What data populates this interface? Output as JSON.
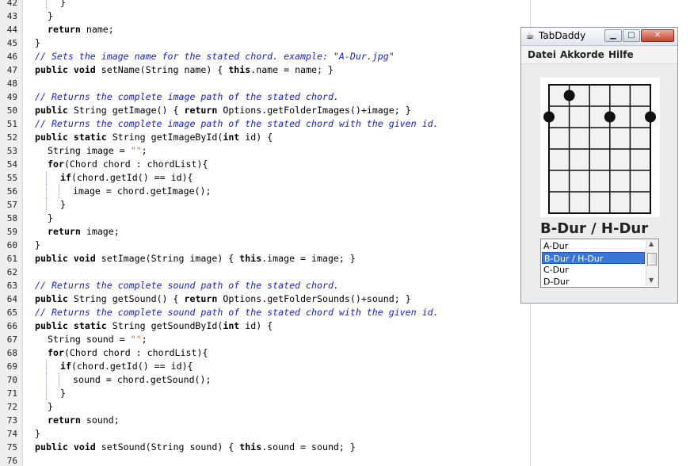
{
  "editor": {
    "lines": [
      {
        "n": "42",
        "indent": 3,
        "segs": [
          [
            "p",
            "}"
          ]
        ]
      },
      {
        "n": "43",
        "indent": 2,
        "segs": [
          [
            "p",
            "}"
          ]
        ]
      },
      {
        "n": "44",
        "indent": 2,
        "segs": [
          [
            "k",
            "return"
          ],
          [
            "p",
            " name;"
          ]
        ]
      },
      {
        "n": "45",
        "indent": 1,
        "segs": [
          [
            "p",
            "}"
          ]
        ]
      },
      {
        "n": "46",
        "indent": 1,
        "segs": [
          [
            "c",
            "// Sets the image name for the stated chord. example: \"A-Dur.jpg\""
          ]
        ]
      },
      {
        "n": "47",
        "indent": 1,
        "segs": [
          [
            "k",
            "public void"
          ],
          [
            "p",
            " setName(String name) { "
          ],
          [
            "k",
            "this"
          ],
          [
            "p",
            ".name = name; }"
          ]
        ]
      },
      {
        "n": "48",
        "indent": 0,
        "segs": []
      },
      {
        "n": "49",
        "indent": 1,
        "segs": [
          [
            "c",
            "// Returns the complete image path of the stated chord."
          ]
        ]
      },
      {
        "n": "50",
        "indent": 1,
        "segs": [
          [
            "k",
            "public"
          ],
          [
            "p",
            " String getImage() { "
          ],
          [
            "k",
            "return"
          ],
          [
            "p",
            " Options.getFolderImages()+image; }"
          ]
        ]
      },
      {
        "n": "51",
        "indent": 1,
        "segs": [
          [
            "c",
            "// Returns the complete image path of the stated chord with the given id."
          ]
        ]
      },
      {
        "n": "52",
        "indent": 1,
        "segs": [
          [
            "k",
            "public static"
          ],
          [
            "p",
            " String getImageById("
          ],
          [
            "k",
            "int"
          ],
          [
            "p",
            " id) {"
          ]
        ]
      },
      {
        "n": "53",
        "indent": 2,
        "segs": [
          [
            "p",
            "String image = "
          ],
          [
            "s",
            "\"\""
          ],
          [
            "p",
            ";"
          ]
        ]
      },
      {
        "n": "54",
        "indent": 2,
        "segs": [
          [
            "k",
            "for"
          ],
          [
            "p",
            "(Chord chord : chordList){"
          ]
        ]
      },
      {
        "n": "55",
        "indent": 3,
        "segs": [
          [
            "k",
            "if"
          ],
          [
            "p",
            "(chord.getId() == id){"
          ]
        ]
      },
      {
        "n": "56",
        "indent": 4,
        "segs": [
          [
            "p",
            "image = chord.getImage();"
          ]
        ]
      },
      {
        "n": "57",
        "indent": 3,
        "segs": [
          [
            "p",
            "}"
          ]
        ]
      },
      {
        "n": "58",
        "indent": 2,
        "segs": [
          [
            "p",
            "}"
          ]
        ]
      },
      {
        "n": "59",
        "indent": 2,
        "segs": [
          [
            "k",
            "return"
          ],
          [
            "p",
            " image;"
          ]
        ]
      },
      {
        "n": "60",
        "indent": 1,
        "segs": [
          [
            "p",
            "}"
          ]
        ]
      },
      {
        "n": "61",
        "indent": 1,
        "segs": [
          [
            "k",
            "public void"
          ],
          [
            "p",
            " setImage(String image) { "
          ],
          [
            "k",
            "this"
          ],
          [
            "p",
            ".image = image; }"
          ]
        ]
      },
      {
        "n": "62",
        "indent": 0,
        "segs": []
      },
      {
        "n": "63",
        "indent": 1,
        "segs": [
          [
            "c",
            "// Returns the complete sound path of the stated chord."
          ]
        ]
      },
      {
        "n": "64",
        "indent": 1,
        "segs": [
          [
            "k",
            "public"
          ],
          [
            "p",
            " String getSound() { "
          ],
          [
            "k",
            "return"
          ],
          [
            "p",
            " Options.getFolderSounds()+sound; }"
          ]
        ]
      },
      {
        "n": "65",
        "indent": 1,
        "segs": [
          [
            "c",
            "// Returns the complete sound path of the stated chord with the given id."
          ]
        ]
      },
      {
        "n": "66",
        "indent": 1,
        "segs": [
          [
            "k",
            "public static"
          ],
          [
            "p",
            " String getSoundById("
          ],
          [
            "k",
            "int"
          ],
          [
            "p",
            " id) {"
          ]
        ]
      },
      {
        "n": "67",
        "indent": 2,
        "segs": [
          [
            "p",
            "String sound = "
          ],
          [
            "s",
            "\"\""
          ],
          [
            "p",
            ";"
          ]
        ]
      },
      {
        "n": "68",
        "indent": 2,
        "segs": [
          [
            "k",
            "for"
          ],
          [
            "p",
            "(Chord chord : chordList){"
          ]
        ]
      },
      {
        "n": "69",
        "indent": 3,
        "segs": [
          [
            "k",
            "if"
          ],
          [
            "p",
            "(chord.getId() == id){"
          ]
        ]
      },
      {
        "n": "70",
        "indent": 4,
        "segs": [
          [
            "p",
            "sound = chord.getSound();"
          ]
        ]
      },
      {
        "n": "71",
        "indent": 3,
        "segs": [
          [
            "p",
            "}"
          ]
        ]
      },
      {
        "n": "72",
        "indent": 2,
        "segs": [
          [
            "p",
            "}"
          ]
        ]
      },
      {
        "n": "73",
        "indent": 2,
        "segs": [
          [
            "k",
            "return"
          ],
          [
            "p",
            " sound;"
          ]
        ]
      },
      {
        "n": "74",
        "indent": 1,
        "segs": [
          [
            "p",
            "}"
          ]
        ]
      },
      {
        "n": "75",
        "indent": 1,
        "segs": [
          [
            "k",
            "public void"
          ],
          [
            "p",
            " setSound(String sound) { "
          ],
          [
            "k",
            "this"
          ],
          [
            "p",
            ".sound = sound; }"
          ]
        ]
      },
      {
        "n": "76",
        "indent": 0,
        "segs": []
      }
    ]
  },
  "window": {
    "title": "TabDaddy",
    "icon": "java-cup-icon",
    "controls": {
      "minimize": "minimize-icon",
      "maximize": "maximize-icon",
      "close": "close-icon"
    },
    "menus": [
      "Datei",
      "Akkorde",
      "Hilfe"
    ],
    "chord_diagram": {
      "strings": 6,
      "frets": 6,
      "dots": [
        {
          "string": 2,
          "fret": 1
        },
        {
          "string": 1,
          "fret": 2
        },
        {
          "string": 4,
          "fret": 2
        },
        {
          "string": 6,
          "fret": 2
        }
      ]
    },
    "chord_name": "B-Dur / H-Dur",
    "chord_list": {
      "items": [
        "A-Dur",
        "B-Dur / H-Dur",
        "C-Dur",
        "D-Dur"
      ],
      "selected_index": 1
    }
  },
  "colors": {
    "comment": "#1a24c8",
    "string": "#c26a2a",
    "selection": "#3a76d6",
    "close_button": "#c8412b"
  }
}
